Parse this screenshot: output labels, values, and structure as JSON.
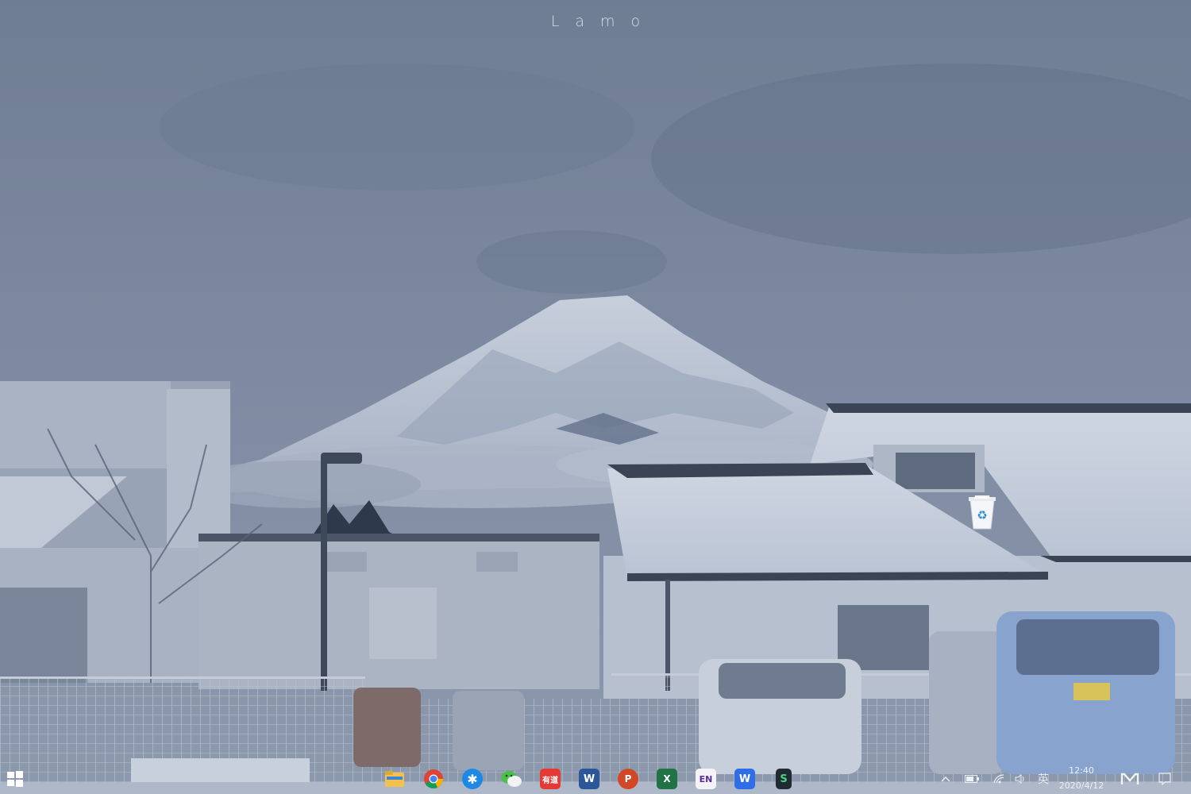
{
  "desktop": {
    "title": "Lamo",
    "icons": [
      {
        "name": "recycle-bin",
        "label": ""
      }
    ]
  },
  "taskbar": {
    "start_icon": "windows-logo-icon",
    "apps": [
      {
        "icon": "file-explorer-icon",
        "text": ""
      },
      {
        "icon": "chrome-icon",
        "text": ""
      },
      {
        "icon": "app-star-icon",
        "text": ""
      },
      {
        "icon": "wechat-icon",
        "text": ""
      },
      {
        "icon": "youdao-icon",
        "text": "有道"
      },
      {
        "icon": "word-icon",
        "text": "W"
      },
      {
        "icon": "powerpoint-icon",
        "text": "P"
      },
      {
        "icon": "excel-icon",
        "text": "X"
      },
      {
        "icon": "en-dictionary-icon",
        "text": "EN"
      },
      {
        "icon": "wps-icon",
        "text": "W"
      },
      {
        "icon": "app-s-icon",
        "text": "S"
      }
    ],
    "tray": {
      "chevron_icon": "chevron-up-icon",
      "battery_icon": "battery-icon",
      "wifi_icon": "wifi-icon",
      "volume_icon": "volume-icon",
      "ime_label": "英",
      "time": "12:40",
      "date": "2020/4/12",
      "extra_icon": "app-m-icon",
      "notification_icon": "notification-icon"
    }
  },
  "colors": {
    "sky": "#7d8aa1",
    "mountain_snow": "#d5dbe6",
    "roof": "#3a4454",
    "car_blue": "#8aa6d0"
  }
}
